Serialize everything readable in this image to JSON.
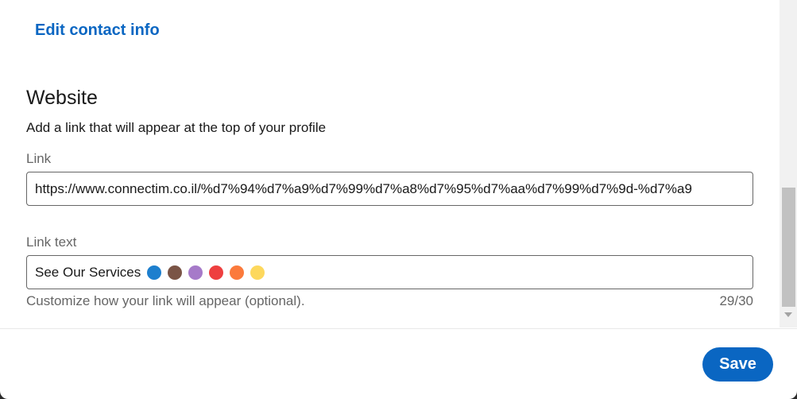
{
  "contact": {
    "edit_link": "Edit contact info"
  },
  "website": {
    "title": "Website",
    "description": "Add a link that will appear at the top of your profile",
    "link_label": "Link",
    "link_value": "https://www.connectim.co.il/%d7%94%d7%a9%d7%99%d7%a8%d7%95%d7%aa%d7%99%d7%9d-%d7%a9",
    "link_text_label": "Link text",
    "link_text_value": "See Our Services",
    "link_text_emojis": [
      {
        "name": "blue-circle-emoji",
        "color": "#1d7fce"
      },
      {
        "name": "brown-circle-emoji",
        "color": "#7a5446"
      },
      {
        "name": "purple-circle-emoji",
        "color": "#a67ac9"
      },
      {
        "name": "red-circle-emoji",
        "color": "#ee3f3f"
      },
      {
        "name": "orange-circle-emoji",
        "color": "#fb7a3c"
      },
      {
        "name": "yellow-circle-emoji",
        "color": "#fdd85d"
      }
    ],
    "helper_text": "Customize how your link will appear (optional).",
    "char_counter": "29/30"
  },
  "footer": {
    "save_label": "Save"
  },
  "colors": {
    "accent": "#0a66c2",
    "text_primary": "#191919",
    "text_secondary": "#666666"
  }
}
